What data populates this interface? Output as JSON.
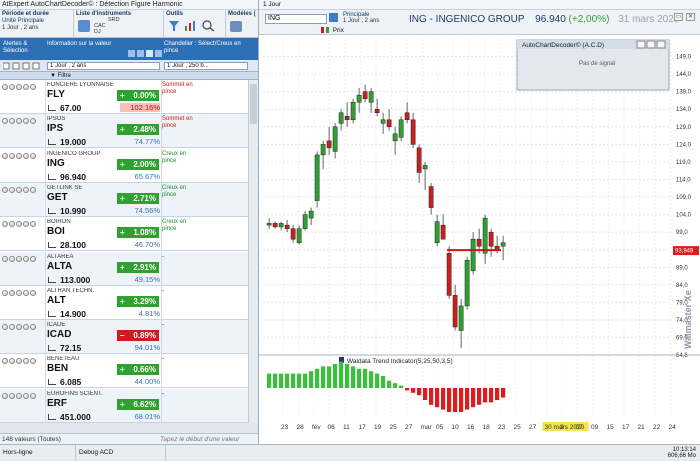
{
  "left_title": "AtExpert AutoChartDecoder© : Détection Figure Harmonic",
  "ribbon": {
    "period_label": "Période et durée",
    "unit_label": "Unité Principale",
    "unit_value": "1 Jour , 2 ans",
    "instruments_label": "Liste d'instruments",
    "instruments_items": [
      "SRD",
      "CAC",
      "DJ"
    ],
    "tools_label": "Outils",
    "models_label": "Modèles ("
  },
  "list_header": {
    "col_alerts": "Alertes & Sélection",
    "col_info": "Information sur la valeur",
    "col_signal": "Chandelier : Sélect/Creux en pince",
    "combo_period": "1 Jour , 2 ans",
    "combo_signal": "1 Jour , 250 b...",
    "filter_label": "Filtre"
  },
  "instruments": [
    {
      "name": "FONCIERE LYONNAISE",
      "ticker": "FLY",
      "change": "0.00%",
      "sign": "+",
      "dir": "up",
      "price": "67.00",
      "pct": "102.16%",
      "pct_hi": true,
      "signal": "Sommet en pince",
      "signal_color": "red"
    },
    {
      "name": "IPSOS",
      "ticker": "IPS",
      "change": "2.48%",
      "sign": "+",
      "dir": "up",
      "price": "19.000",
      "pct": "74.77%",
      "pct_hi": false,
      "signal": "Sommet en pince",
      "signal_color": "red"
    },
    {
      "name": "INGENICO GROUP",
      "ticker": "ING",
      "change": "2.00%",
      "sign": "+",
      "dir": "up",
      "price": "96.940",
      "pct": "65.67%",
      "pct_hi": false,
      "signal": "Creux en pince",
      "signal_color": "green"
    },
    {
      "name": "GETLINK SE",
      "ticker": "GET",
      "change": "2.71%",
      "sign": "+",
      "dir": "up",
      "price": "10.990",
      "pct": "74.56%",
      "pct_hi": false,
      "signal": "Creux en pince",
      "signal_color": "green"
    },
    {
      "name": "BOIRON",
      "ticker": "BOI",
      "change": "1.08%",
      "sign": "+",
      "dir": "up",
      "price": "28.100",
      "pct": "46.70%",
      "pct_hi": false,
      "signal": "Creux en pince",
      "signal_color": "green"
    },
    {
      "name": "ALTAREA",
      "ticker": "ALTA",
      "change": "2.91%",
      "sign": "+",
      "dir": "up",
      "price": "113.000",
      "pct": "49.15%",
      "pct_hi": false,
      "signal": "-",
      "signal_color": "plain"
    },
    {
      "name": "ALTRAN TECHN.",
      "ticker": "ALT",
      "change": "3.29%",
      "sign": "+",
      "dir": "up",
      "price": "14.900",
      "pct": "4.81%",
      "pct_hi": false,
      "signal": "-",
      "signal_color": "plain"
    },
    {
      "name": "ICADE",
      "ticker": "ICAD",
      "change": "0.89%",
      "sign": "–",
      "dir": "dn",
      "price": "72.15",
      "pct": "94.01%",
      "pct_hi": false,
      "signal": "-",
      "signal_color": "plain"
    },
    {
      "name": "BENETEAU",
      "ticker": "BEN",
      "change": "0.66%",
      "sign": "+",
      "dir": "up",
      "price": "6.085",
      "pct": "44.00%",
      "pct_hi": false,
      "signal": "-",
      "signal_color": "plain"
    },
    {
      "name": "EUROFINS SCIENT.",
      "ticker": "ERF",
      "change": "6.62%",
      "sign": "+",
      "dir": "up",
      "price": "451.000",
      "pct": "68.01%",
      "pct_hi": false,
      "signal": "-",
      "signal_color": "plain"
    }
  ],
  "left_footer": {
    "count": "148 valeurs (Toutes)",
    "typing_hint": "Tapez le début d'une valeur"
  },
  "status": {
    "mode": "Hors-ligne",
    "debug": "Debug ACD",
    "time": "10:13:14",
    "memory": "606,66 Mo"
  },
  "chart": {
    "tab": "1 Jour",
    "symbol": "ING",
    "unit_label": "Principale",
    "unit_value": "1 Jour , 2 ans",
    "title": "ING - INGENICO GROUP",
    "price": "96.940",
    "change": "(+2,00%)",
    "date": "31 mars 2020",
    "series_label": "Prix",
    "price_tag": "93,949",
    "widget_title": "AutoChartDecoder© (A.C.D)",
    "widget_text": "Pas de signal",
    "watermark": "Walmaster Xe",
    "indicator_label": "Waldata Trend Indicator(5,25,50,3,5)",
    "date_highlight": "30 mars 2020",
    "colors": {
      "up": "#2ea12e",
      "down": "#cc1e1e",
      "title": "#1a3b66",
      "change": "#2ea12e"
    }
  },
  "chart_data": {
    "type": "candlestick",
    "ylim": [
      64.6,
      154
    ],
    "yticks": [
      "149,0",
      "144,0",
      "139,0",
      "134,0",
      "129,0",
      "124,0",
      "119,0",
      "114,0",
      "109,0",
      "104,0",
      "99,0",
      "94,0",
      "89,0",
      "84,0",
      "79,0",
      "74,0",
      "69,6",
      "64,6"
    ],
    "xticks": [
      "23",
      "28",
      "fév",
      "06",
      "11",
      "17",
      "19",
      "25",
      "27",
      "mar",
      "05",
      "10",
      "16",
      "18",
      "23",
      "25",
      "27",
      "30 mars 2020",
      "3",
      "07",
      "09",
      "15",
      "17",
      "21",
      "22",
      "24"
    ],
    "candles": [
      [
        101,
        103,
        100,
        101.5
      ],
      [
        101.5,
        102,
        100,
        100.5
      ],
      [
        100.5,
        102,
        99.5,
        101.5
      ],
      [
        101,
        102.5,
        99,
        100
      ],
      [
        100,
        101,
        96,
        97
      ],
      [
        96,
        101,
        95.5,
        100
      ],
      [
        100,
        105,
        99.5,
        104
      ],
      [
        103,
        106,
        101,
        105
      ],
      [
        108,
        122,
        106,
        121
      ],
      [
        121,
        125,
        117,
        124
      ],
      [
        125,
        129,
        121,
        123
      ],
      [
        122,
        130,
        120,
        129
      ],
      [
        130,
        134,
        128,
        133
      ],
      [
        132,
        136,
        129,
        131
      ],
      [
        131,
        137,
        130,
        136
      ],
      [
        136,
        140,
        133,
        138
      ],
      [
        139,
        141,
        136,
        137
      ],
      [
        136,
        140,
        133,
        139
      ],
      [
        134,
        137,
        132,
        133
      ],
      [
        130,
        133,
        127,
        131
      ],
      [
        131,
        134,
        128,
        129
      ],
      [
        125,
        129,
        121,
        127
      ],
      [
        126,
        132,
        125,
        131
      ],
      [
        133,
        136,
        130,
        131
      ],
      [
        131,
        133,
        123,
        124
      ],
      [
        123,
        124,
        113,
        116
      ],
      [
        117,
        119,
        111,
        118
      ],
      [
        112,
        113,
        104,
        106
      ],
      [
        96,
        104,
        95,
        102
      ],
      [
        101,
        104,
        97,
        97
      ],
      [
        93,
        95,
        80,
        81
      ],
      [
        81,
        84,
        71,
        72
      ],
      [
        71,
        80,
        66,
        78
      ],
      [
        78,
        92,
        77,
        91
      ],
      [
        88,
        99,
        87,
        97
      ],
      [
        97,
        100,
        93,
        95
      ],
      [
        93,
        104,
        90,
        103
      ],
      [
        99,
        100,
        92,
        95
      ],
      [
        95,
        98,
        93,
        94
      ],
      [
        95,
        98,
        91,
        96
      ]
    ],
    "support_level": 93.9,
    "indicator": [
      6,
      6,
      6,
      6,
      6,
      6,
      6,
      7,
      8,
      9,
      9,
      10,
      11,
      10,
      9,
      8,
      8,
      7,
      6,
      5,
      3,
      2,
      1,
      -1,
      -2,
      -3,
      -5,
      -7,
      -8,
      -9,
      -10,
      -10,
      -10,
      -9,
      -8,
      -7,
      -6,
      -6,
      -5,
      -4
    ]
  }
}
